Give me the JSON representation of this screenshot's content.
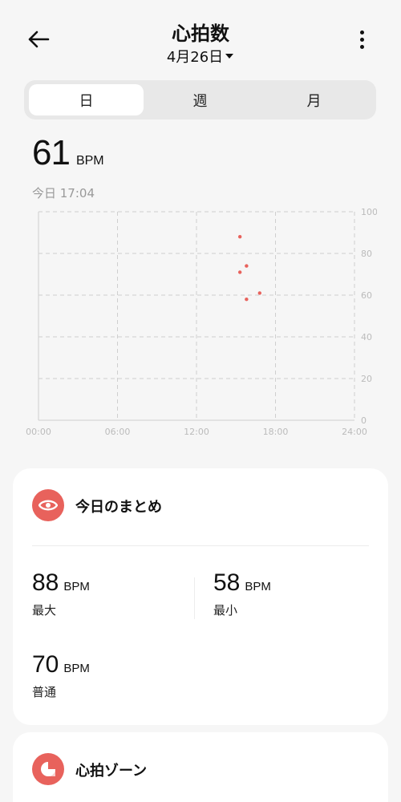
{
  "header": {
    "title": "心拍数",
    "date": "4月26日",
    "back_icon": "arrow-left-icon",
    "menu_icon": "more-vertical-icon"
  },
  "tabs": [
    {
      "label": "日",
      "active": true
    },
    {
      "label": "週",
      "active": false
    },
    {
      "label": "月",
      "active": false
    }
  ],
  "current": {
    "value": "61",
    "unit": "BPM",
    "time": "今日 17:04"
  },
  "chart_data": {
    "type": "scatter",
    "x_ticks": [
      "00:00",
      "06:00",
      "12:00",
      "18:00",
      "24:00"
    ],
    "y_ticks": [
      "0",
      "20",
      "40",
      "60",
      "80",
      "100"
    ],
    "ylim": [
      0,
      100
    ],
    "xlim_hours": [
      0,
      24
    ],
    "grid": true,
    "point_color": "#e8625c",
    "points": [
      {
        "x": 15.3,
        "y": 88
      },
      {
        "x": 15.3,
        "y": 71
      },
      {
        "x": 15.8,
        "y": 74
      },
      {
        "x": 15.8,
        "y": 58
      },
      {
        "x": 16.8,
        "y": 61
      }
    ]
  },
  "summary": {
    "title": "今日のまとめ",
    "icon": "eye-icon",
    "max": {
      "value": "88",
      "unit": "BPM",
      "label": "最大"
    },
    "min": {
      "value": "58",
      "unit": "BPM",
      "label": "最小"
    },
    "avg": {
      "value": "70",
      "unit": "BPM",
      "label": "普通"
    }
  },
  "zones": {
    "title": "心拍ゾーン",
    "icon": "pie-chart-icon"
  },
  "accent_color": "#e8625c"
}
